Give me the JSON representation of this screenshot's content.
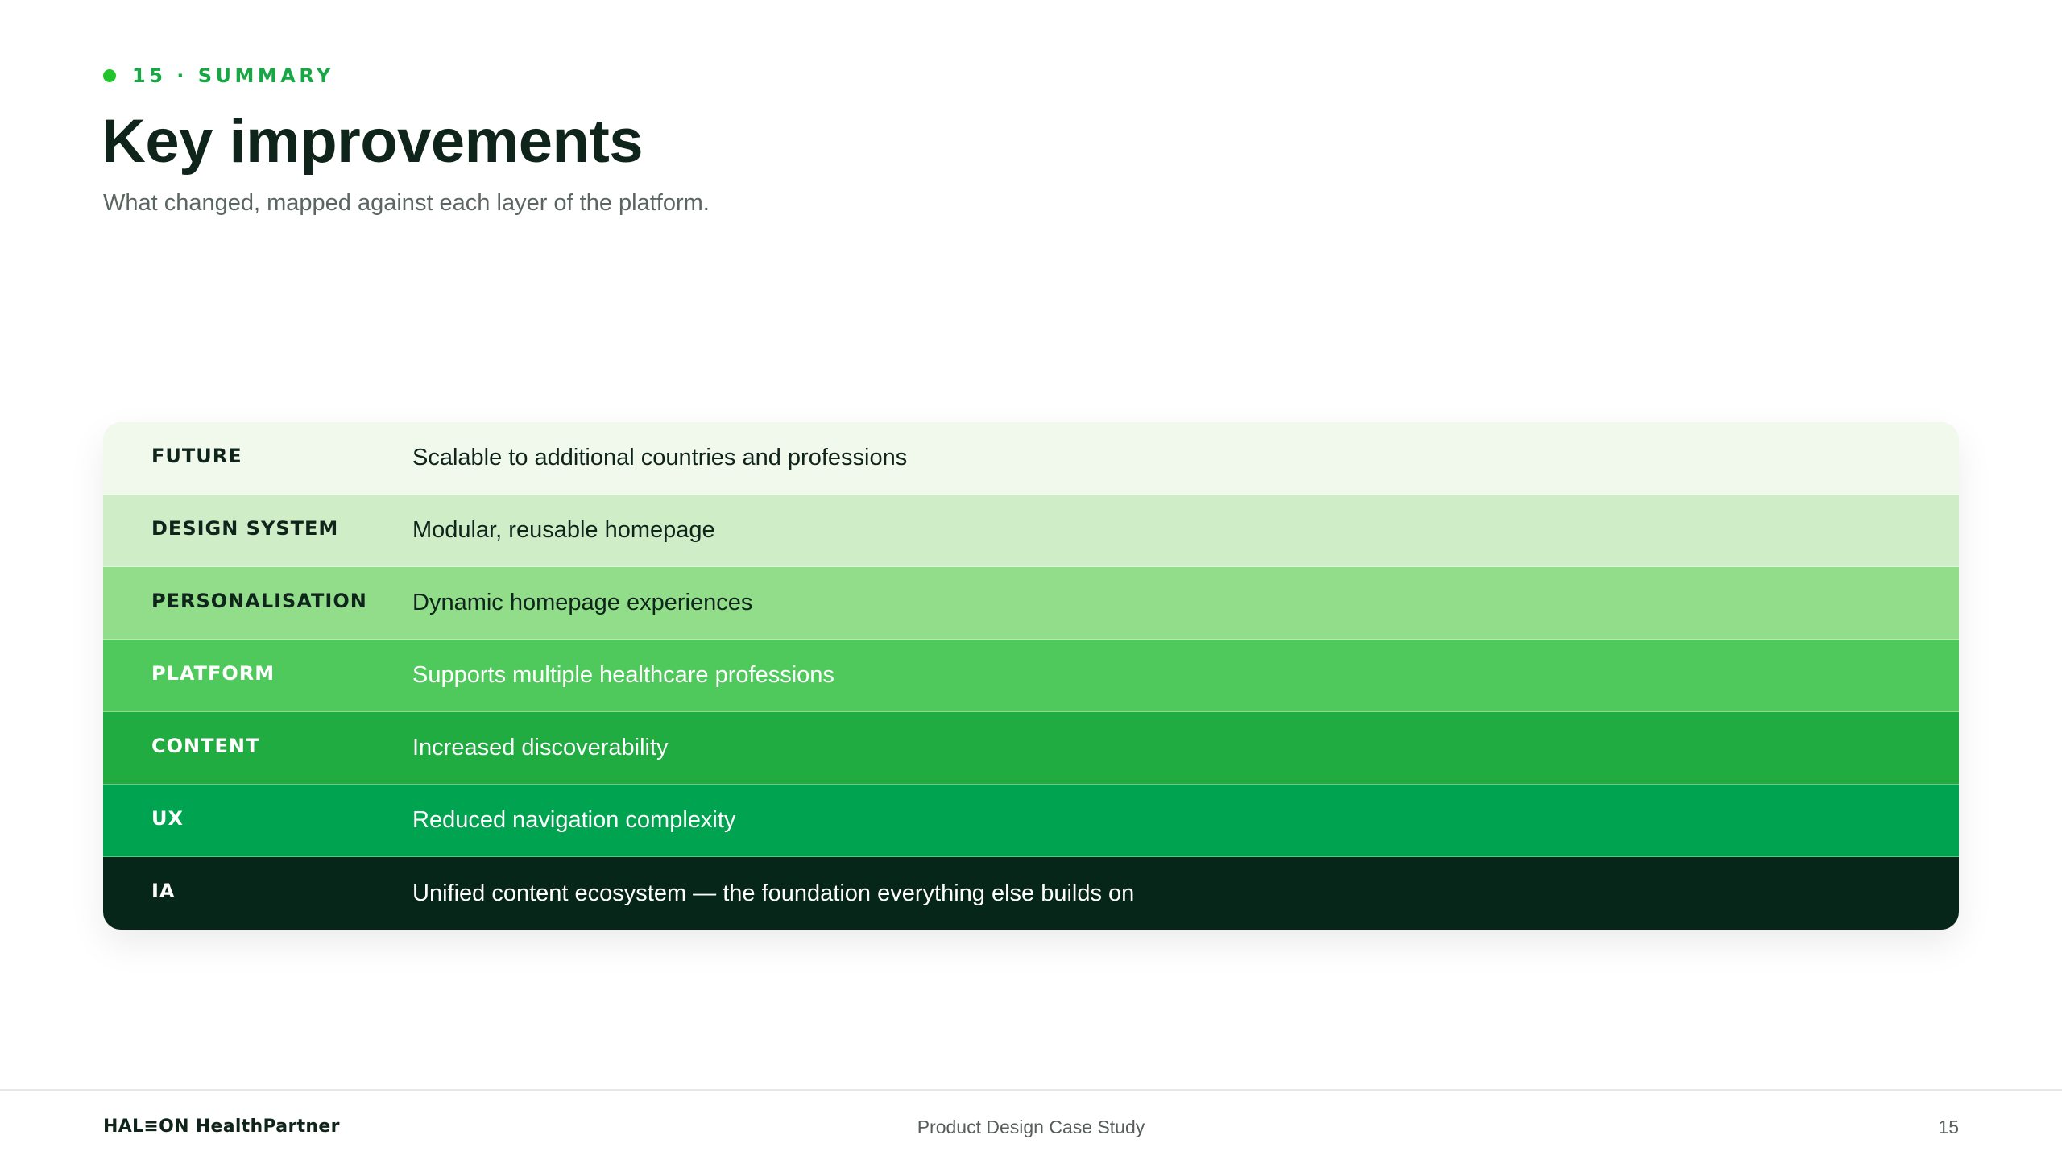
{
  "header": {
    "eyebrow": "15 · SUMMARY",
    "title": "Key improvements",
    "subtitle": "What changed, mapped against each layer of the platform."
  },
  "layers": [
    {
      "name": "FUTURE",
      "description": "Scalable to additional countries and professions",
      "background": "#f0f9ec",
      "name_color": "#0f241b",
      "text_color": "#0f241b"
    },
    {
      "name": "DESIGN SYSTEM",
      "description": "Modular, reusable homepage",
      "background": "#cfeec8",
      "name_color": "#0f241b",
      "text_color": "#0f241b"
    },
    {
      "name": "PERSONALISATION",
      "description": "Dynamic homepage experiences",
      "background": "#91dd8a",
      "name_color": "#0f241b",
      "text_color": "#0f241b"
    },
    {
      "name": "PLATFORM",
      "description": "Supports multiple healthcare professions",
      "background": "#4fc95b",
      "name_color": "#ffffff",
      "text_color": "#ffffff"
    },
    {
      "name": "CONTENT",
      "description": "Increased discoverability",
      "background": "#20ac40",
      "name_color": "#ffffff",
      "text_color": "#ffffff"
    },
    {
      "name": "UX",
      "description": "Reduced navigation complexity",
      "background": "#00a34f",
      "name_color": "#ffffff",
      "text_color": "#ffffff"
    },
    {
      "name": "IA",
      "description": "Unified content ecosystem — the foundation everything else builds on",
      "background": "#06261a",
      "name_color": "#ffffff",
      "text_color": "#ffffff"
    }
  ],
  "footer": {
    "brand": "HAL≡ON HealthPartner",
    "center": "Product Design Case Study",
    "page_number": "15"
  },
  "colors": {
    "accent": "#21c42a",
    "eyebrow": "#17a845"
  }
}
